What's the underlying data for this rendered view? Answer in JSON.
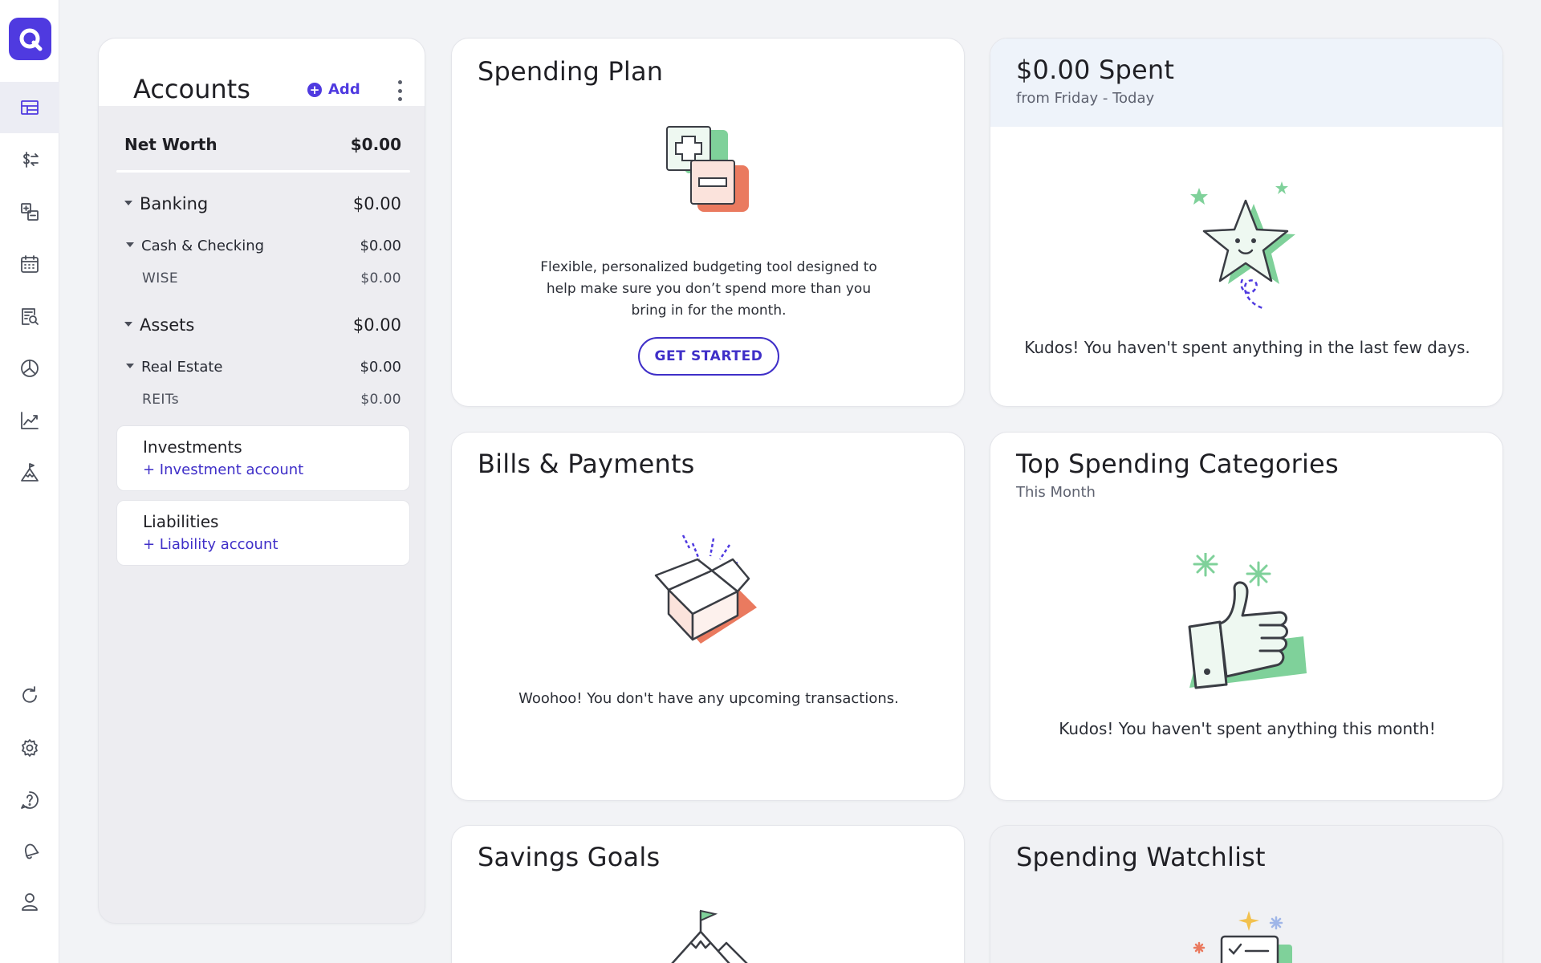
{
  "nav": {
    "items": [
      {
        "name": "dashboard"
      },
      {
        "name": "transactions"
      },
      {
        "name": "bills"
      },
      {
        "name": "calendar"
      },
      {
        "name": "reports"
      },
      {
        "name": "spending"
      },
      {
        "name": "investing"
      },
      {
        "name": "planning"
      }
    ],
    "bottom": [
      {
        "name": "refresh"
      },
      {
        "name": "settings"
      },
      {
        "name": "help"
      },
      {
        "name": "notifications"
      },
      {
        "name": "profile"
      }
    ]
  },
  "accounts": {
    "title": "Accounts",
    "add_label": "Add",
    "net_worth": {
      "label": "Net Worth",
      "value": "$0.00"
    },
    "banking": {
      "label": "Banking",
      "value": "$0.00"
    },
    "cash_checking": {
      "label": "Cash & Checking",
      "value": "$0.00"
    },
    "wise": {
      "label": "WISE",
      "value": "$0.00"
    },
    "assets": {
      "label": "Assets",
      "value": "$0.00"
    },
    "real_estate": {
      "label": "Real Estate",
      "value": "$0.00"
    },
    "reits": {
      "label": "REITs",
      "value": "$0.00"
    },
    "investments": {
      "label": "Investments",
      "link": "+ Investment account"
    },
    "liabilities": {
      "label": "Liabilities",
      "link": "+ Liability account"
    }
  },
  "spending_plan": {
    "title": "Spending Plan",
    "description_lines": [
      "Flexible, personalized budgeting tool designed to",
      "help make sure you don’t spend more than you",
      "bring in for the month."
    ],
    "cta": "GET STARTED"
  },
  "spent": {
    "title": "$0.00 Spent",
    "subtitle": "from Friday - Today",
    "message": "Kudos! You haven't spent anything in the last few days."
  },
  "bills": {
    "title": "Bills & Payments",
    "message": "Woohoo! You don't have any upcoming transactions."
  },
  "top_categories": {
    "title": "Top Spending Categories",
    "subtitle": "This Month",
    "message": "Kudos! You haven't spent anything this month!"
  },
  "savings": {
    "title": "Savings Goals"
  },
  "watchlist": {
    "title": "Spending Watchlist"
  },
  "colors": {
    "accent": "#4f3ae0",
    "green": "#7fd19a",
    "coral": "#ea7a5f"
  }
}
